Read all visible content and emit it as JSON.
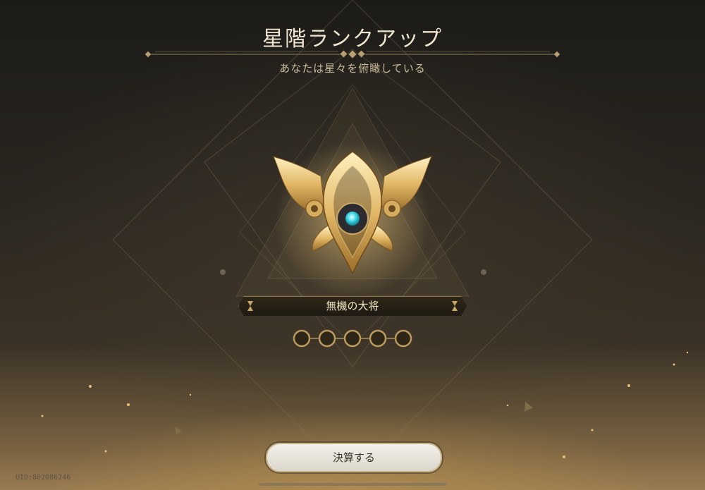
{
  "header": {
    "title": "星階ランクアップ",
    "subtitle": "あなたは星々を俯瞰している"
  },
  "rank": {
    "name": "無機の大将",
    "stars_total": 5,
    "stars_filled": 0,
    "emblem_icon": "rank-emblem-icon"
  },
  "actions": {
    "settle_label": "決算する"
  },
  "footer": {
    "uid": "UID:802086246"
  },
  "colors": {
    "gold": "#c9a866",
    "gem": "#3fd8e8",
    "button_bg": "#efebe4"
  }
}
